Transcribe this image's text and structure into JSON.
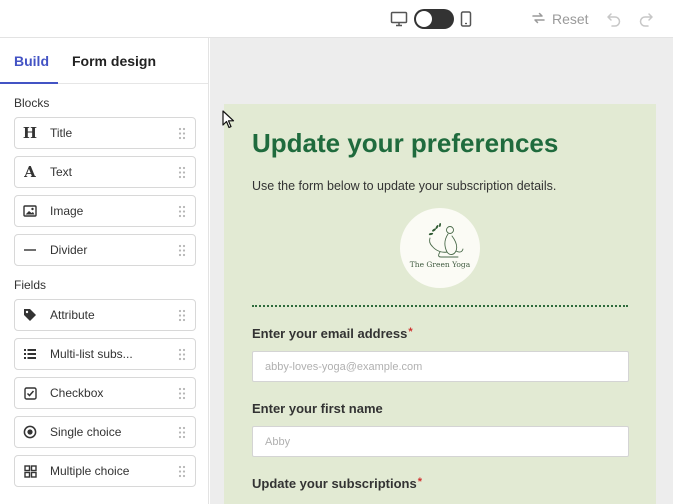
{
  "toolbar": {
    "reset_label": "Reset",
    "icons": [
      "monitor-icon",
      "toggle-switch",
      "phone-icon",
      "reset-icon",
      "undo-icon",
      "redo-icon"
    ]
  },
  "sidebar": {
    "tabs": [
      {
        "label": "Build",
        "active": true
      },
      {
        "label": "Form design",
        "active": false
      }
    ],
    "blocks_title": "Blocks",
    "blocks": [
      {
        "label": "Title",
        "icon": "title-icon"
      },
      {
        "label": "Text",
        "icon": "text-icon"
      },
      {
        "label": "Image",
        "icon": "image-icon"
      },
      {
        "label": "Divider",
        "icon": "divider-icon"
      }
    ],
    "fields_title": "Fields",
    "fields": [
      {
        "label": "Attribute",
        "icon": "tag-icon"
      },
      {
        "label": "Multi-list subs...",
        "icon": "list-icon"
      },
      {
        "label": "Checkbox",
        "icon": "checkbox-icon"
      },
      {
        "label": "Single choice",
        "icon": "radio-icon"
      },
      {
        "label": "Multiple choice",
        "icon": "grid-icon"
      }
    ]
  },
  "form": {
    "title": "Update your preferences",
    "subtitle": "Use the form below to update your subscription details.",
    "logo_text": "The Green Yoga",
    "email_label": "Enter your email address",
    "email_placeholder": "abby-loves-yoga@example.com",
    "firstname_label": "Enter your first name",
    "firstname_placeholder": "Abby",
    "subscriptions_label": "Update your subscriptions",
    "required_mark": "*"
  },
  "colors": {
    "accent": "#4353c4",
    "form_background": "#e2ead3",
    "form_title": "#1f6b3d",
    "required": "#d0322f"
  }
}
